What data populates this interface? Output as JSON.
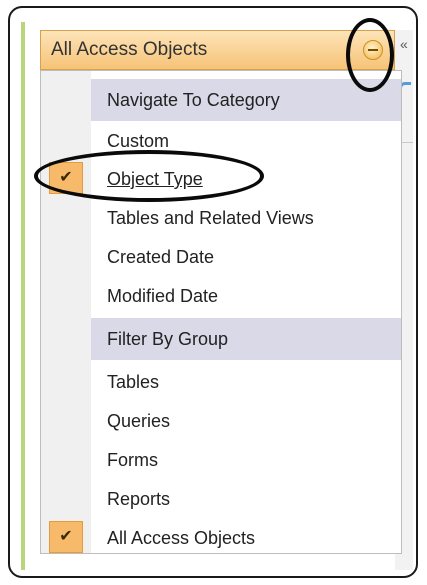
{
  "header": {
    "title": "All Access Objects"
  },
  "shutter_glyph": "«",
  "check_glyph": "✔",
  "menu": {
    "categories": [
      {
        "label": "Navigate To Category",
        "items": [
          {
            "label": "Custom",
            "checked": false
          },
          {
            "label": "Object Type",
            "checked": true
          },
          {
            "label": "Tables and Related Views",
            "checked": false
          },
          {
            "label": "Created Date",
            "checked": false
          },
          {
            "label": "Modified Date",
            "checked": false
          }
        ]
      },
      {
        "label": "Filter By Group",
        "items": [
          {
            "label": "Tables",
            "checked": false
          },
          {
            "label": "Queries",
            "checked": false
          },
          {
            "label": "Forms",
            "checked": false
          },
          {
            "label": "Reports",
            "checked": false
          },
          {
            "label": "All Access Objects",
            "checked": true
          }
        ]
      }
    ]
  }
}
